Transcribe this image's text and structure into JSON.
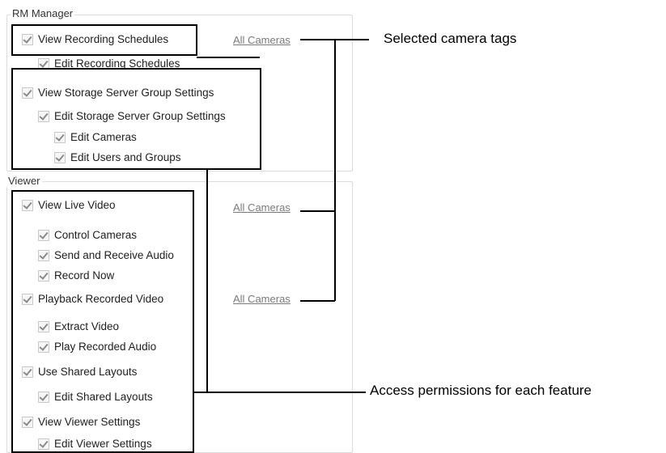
{
  "rm_manager": {
    "legend": "RM Manager",
    "items": [
      {
        "label": "View Recording Schedules",
        "checked": true
      },
      {
        "label": "Edit Recording Schedules",
        "checked": true
      },
      {
        "label": "View Storage Server Group Settings",
        "checked": true
      },
      {
        "label": "Edit Storage Server Group Settings",
        "checked": true
      },
      {
        "label": "Edit Cameras",
        "checked": true
      },
      {
        "label": "Edit Users and Groups",
        "checked": true
      }
    ],
    "camera_link": "All Cameras"
  },
  "viewer": {
    "legend": "Viewer",
    "items": [
      {
        "label": "View Live Video",
        "checked": true
      },
      {
        "label": "Control Cameras",
        "checked": true
      },
      {
        "label": "Send and Receive Audio",
        "checked": true
      },
      {
        "label": "Record Now",
        "checked": true
      },
      {
        "label": "Playback Recorded Video",
        "checked": true
      },
      {
        "label": "Extract Video",
        "checked": true
      },
      {
        "label": "Play Recorded Audio",
        "checked": true
      },
      {
        "label": "Use Shared Layouts",
        "checked": true
      },
      {
        "label": "Edit Shared Layouts",
        "checked": true
      },
      {
        "label": "View Viewer Settings",
        "checked": true
      },
      {
        "label": "Edit Viewer Settings",
        "checked": true
      }
    ],
    "camera_links": [
      "All Cameras",
      "All Cameras"
    ]
  },
  "callouts": {
    "selected_camera_tags": "Selected camera tags",
    "access_permissions": "Access permissions for each feature"
  }
}
